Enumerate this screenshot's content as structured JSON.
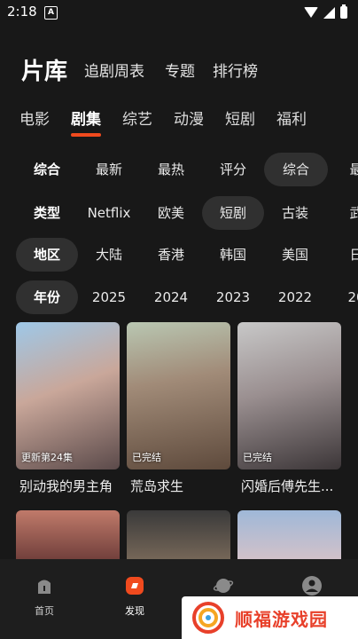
{
  "status": {
    "time": "2:18",
    "notif": "A"
  },
  "header": {
    "title": "片库",
    "links": [
      "追剧周表",
      "专题",
      "排行榜"
    ]
  },
  "categories": [
    "电影",
    "剧集",
    "综艺",
    "动漫",
    "短剧",
    "福利"
  ],
  "filters": {
    "sort": [
      "综合",
      "最新",
      "最热",
      "评分",
      "综合",
      "最"
    ],
    "type": [
      "类型",
      "Netflix",
      "欧美",
      "短剧",
      "古装",
      "武"
    ],
    "region": [
      "地区",
      "大陆",
      "香港",
      "韩国",
      "美国",
      "日"
    ],
    "year": [
      "年份",
      "2025",
      "2024",
      "2023",
      "2022",
      "20"
    ]
  },
  "posters": [
    {
      "badge": "更新第24集",
      "title": "别动我的男主角"
    },
    {
      "badge": "已完结",
      "title": "荒岛求生"
    },
    {
      "badge": "已完结",
      "title": "闪婚后傅先生..."
    }
  ],
  "nav": [
    "首页",
    "发现",
    "",
    ""
  ],
  "watermark": "顺福游戏园",
  "colors": {
    "accent": "#f04a1e",
    "bg": "#181818",
    "chip": "#303030"
  }
}
